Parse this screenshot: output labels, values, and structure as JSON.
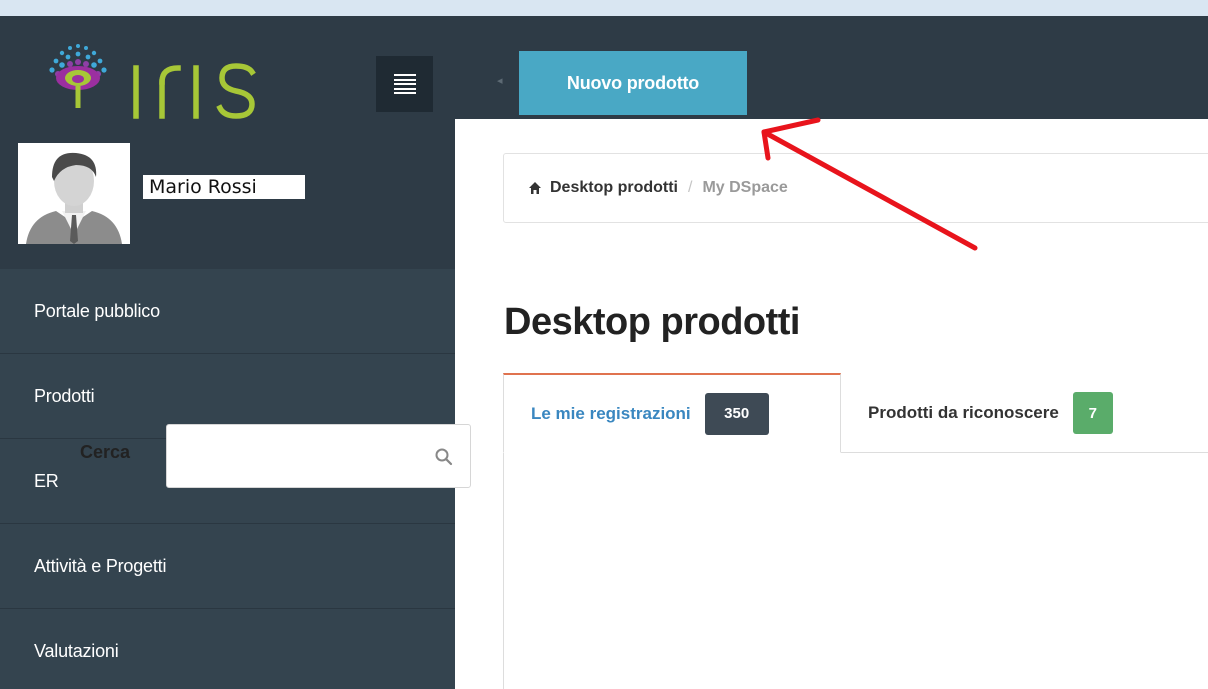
{
  "app": {
    "logo_text": "IRIS"
  },
  "topbar": {
    "new_product_label": "Nuovo prodotto"
  },
  "user": {
    "name": "Mario Rossi"
  },
  "sidebar": {
    "items": [
      {
        "label": "Portale pubblico"
      },
      {
        "label": "Prodotti"
      },
      {
        "label": "ER"
      },
      {
        "label": "Attività e Progetti"
      },
      {
        "label": "Valutazioni"
      }
    ]
  },
  "breadcrumb": {
    "home_label": "Desktop prodotti",
    "separator": "/",
    "current_label": "My DSpace"
  },
  "main": {
    "title": "Desktop prodotti",
    "tabs": [
      {
        "label": "Le mie registrazioni",
        "badge": "350"
      },
      {
        "label": "Prodotti da riconoscere",
        "badge": "7"
      }
    ],
    "search": {
      "label": "Cerca",
      "value": "",
      "placeholder": ""
    }
  },
  "colors": {
    "topbar": "#2e3b46",
    "sidebar": "#34444f",
    "accent_button": "#49a8c5",
    "active_tab_text": "#3a87c0",
    "active_tab_border": "#e0734f",
    "badge_dark": "#3e4a55",
    "badge_green": "#5aac6a",
    "annotation_arrow": "#e8141c"
  },
  "icons": {
    "home": "home-icon",
    "menu": "hamburger-menu-icon",
    "search": "search-icon"
  }
}
